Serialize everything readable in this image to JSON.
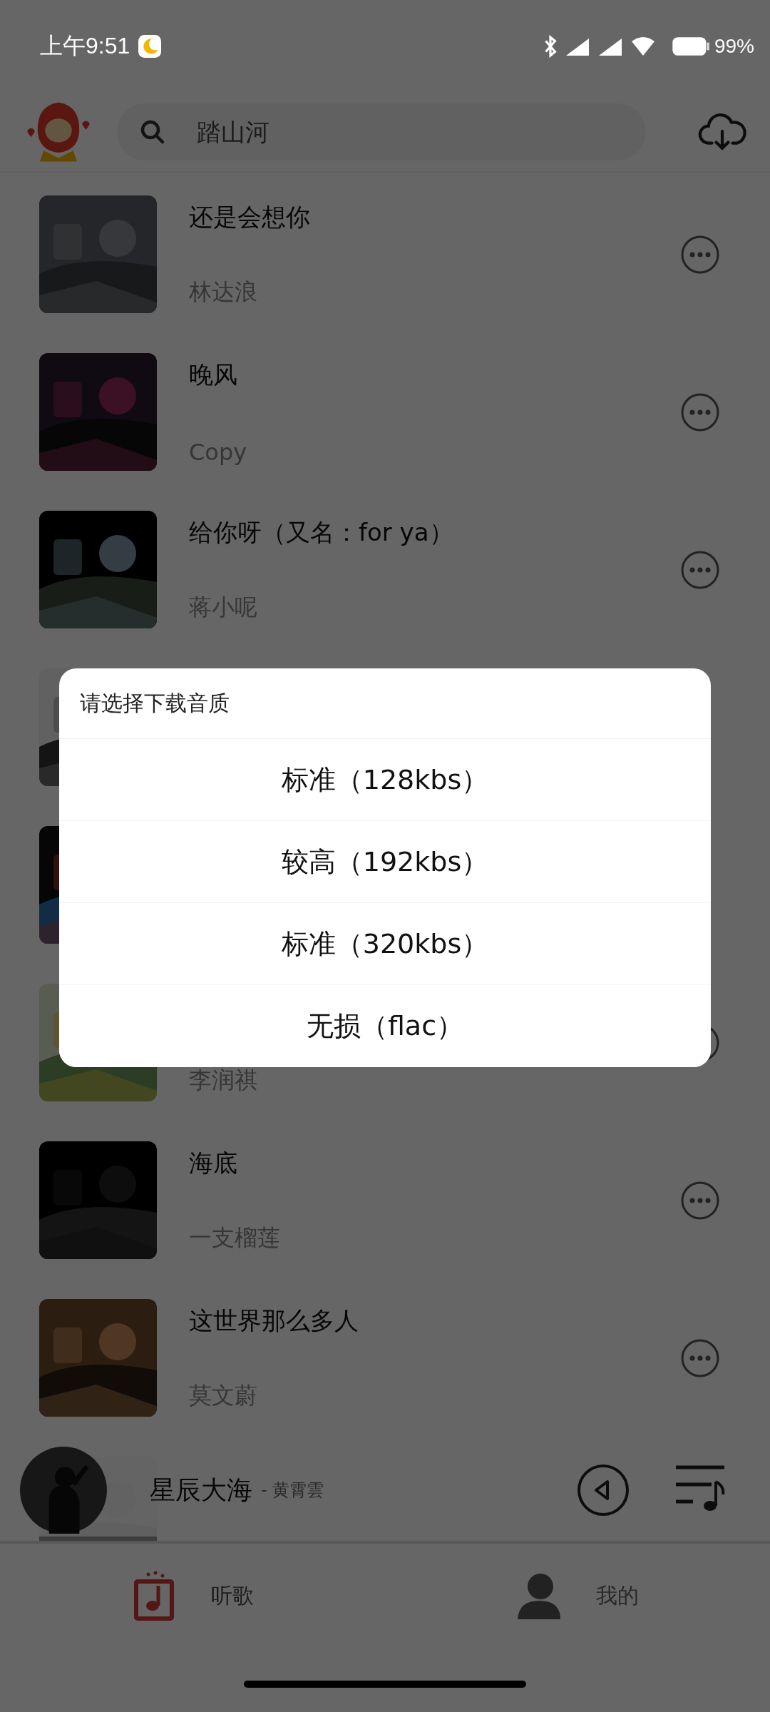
{
  "status_bar": {
    "time": "上午9:51",
    "battery": "99%"
  },
  "search": {
    "placeholder": "踏山河"
  },
  "songs": [
    {
      "kind": "song",
      "title": "还是会想你",
      "artist": "林达浪"
    },
    {
      "kind": "song",
      "title": "晚风",
      "artist": "Copy"
    },
    {
      "kind": "song",
      "title": "给你呀（又名：for ya）",
      "artist": "蒋小呢"
    },
    {
      "kind": "covered"
    },
    {
      "kind": "covered"
    },
    {
      "kind": "song",
      "artist": "李润祺"
    },
    {
      "kind": "song",
      "title": "海底",
      "artist": "一支榴莲"
    },
    {
      "kind": "song",
      "title": "这世界那么多人",
      "artist": "莫文蔚"
    },
    {
      "kind": "covered"
    }
  ],
  "mini_player": {
    "title": "星辰大海",
    "subtitle": "- 黄霄雲"
  },
  "nav": [
    {
      "kind": "music",
      "label": "听歌",
      "selected": true
    },
    {
      "kind": "profile",
      "label": "我的",
      "selected": false
    }
  ],
  "dialog": {
    "title": "请选择下载音质",
    "options": [
      "标准（128kbs）",
      "较高（192kbs）",
      "标准（320kbs）",
      "无损（flac）"
    ]
  }
}
